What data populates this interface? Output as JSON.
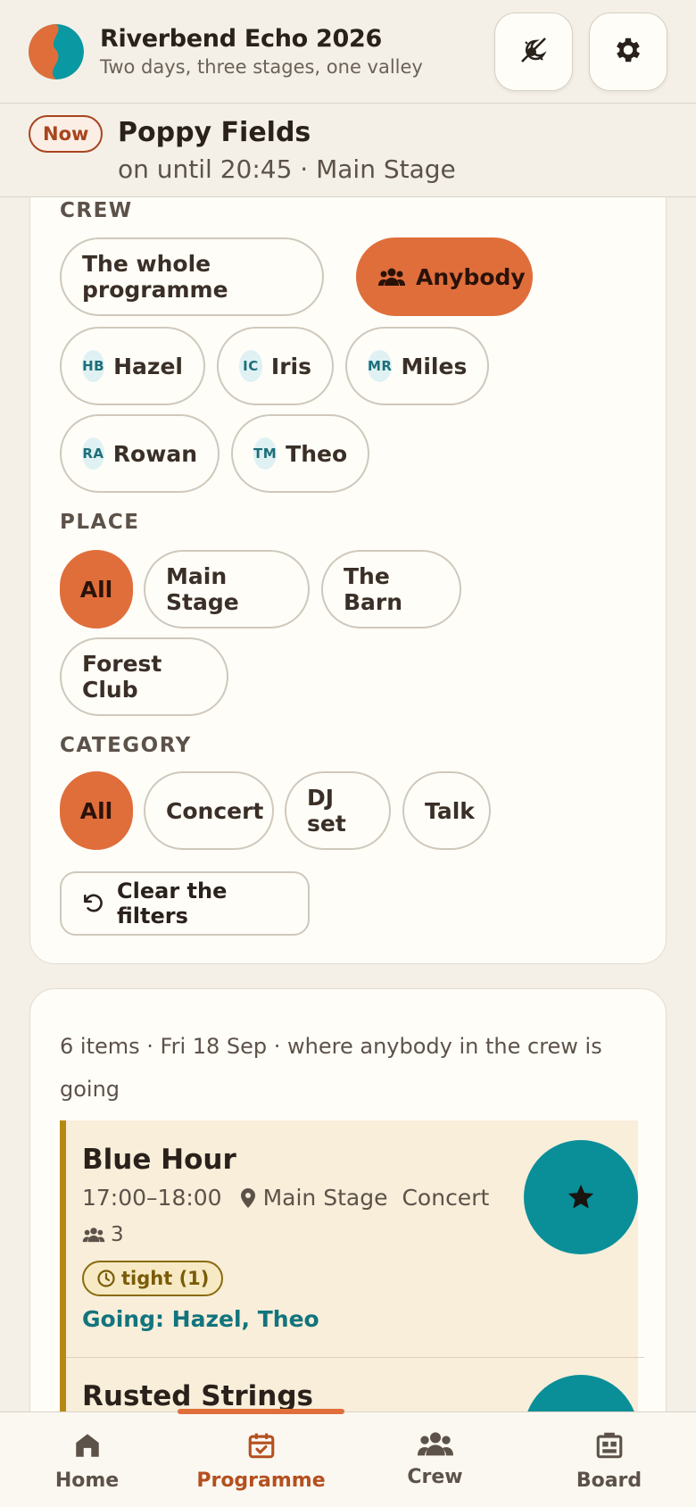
{
  "app": {
    "title": "Riverbend Echo 2026",
    "subtitle": "Two days, three stages, one valley"
  },
  "now_playing": {
    "badge": "Now",
    "title": "Poppy Fields",
    "detail": "on until 20:45 · Main Stage"
  },
  "filters": {
    "crew": {
      "label": "CREW",
      "options": [
        {
          "label": "The whole programme",
          "active": false
        },
        {
          "label": "Anybody",
          "active": true,
          "icon": "group-icon"
        }
      ],
      "members": [
        {
          "initials": "HB",
          "name": "Hazel"
        },
        {
          "initials": "IC",
          "name": "Iris"
        },
        {
          "initials": "MR",
          "name": "Miles"
        },
        {
          "initials": "RA",
          "name": "Rowan"
        },
        {
          "initials": "TM",
          "name": "Theo"
        }
      ]
    },
    "place": {
      "label": "PLACE",
      "options": [
        "All",
        "Main Stage",
        "The Barn",
        "Forest Club"
      ],
      "selected": "All"
    },
    "category": {
      "label": "CATEGORY",
      "options": [
        "All",
        "Concert",
        "DJ set",
        "Talk"
      ],
      "selected": "All"
    },
    "clear_label": "Clear the filters"
  },
  "list": {
    "summary": "6 items · Fri 18 Sep · where anybody in the crew is going",
    "events": [
      {
        "title": "Blue Hour",
        "time": "17:00–18:00",
        "place": "Main Stage",
        "category": "Concert",
        "crew_count": "3",
        "clash": "tight (1)",
        "going": "Going: Hazel, Theo"
      },
      {
        "title": "Rusted Strings"
      }
    ]
  },
  "nav": {
    "items": [
      {
        "label": "Home",
        "icon": "home-icon"
      },
      {
        "label": "Programme",
        "icon": "calendar-check-icon",
        "active": true
      },
      {
        "label": "Crew",
        "icon": "group-icon"
      },
      {
        "label": "Board",
        "icon": "board-icon"
      }
    ]
  },
  "colors": {
    "accent": "#e06e3b",
    "teal": "#0a8f99",
    "background": "#f4f0e7",
    "card": "#fffdf8",
    "highlight_row": "#f8eeda"
  }
}
